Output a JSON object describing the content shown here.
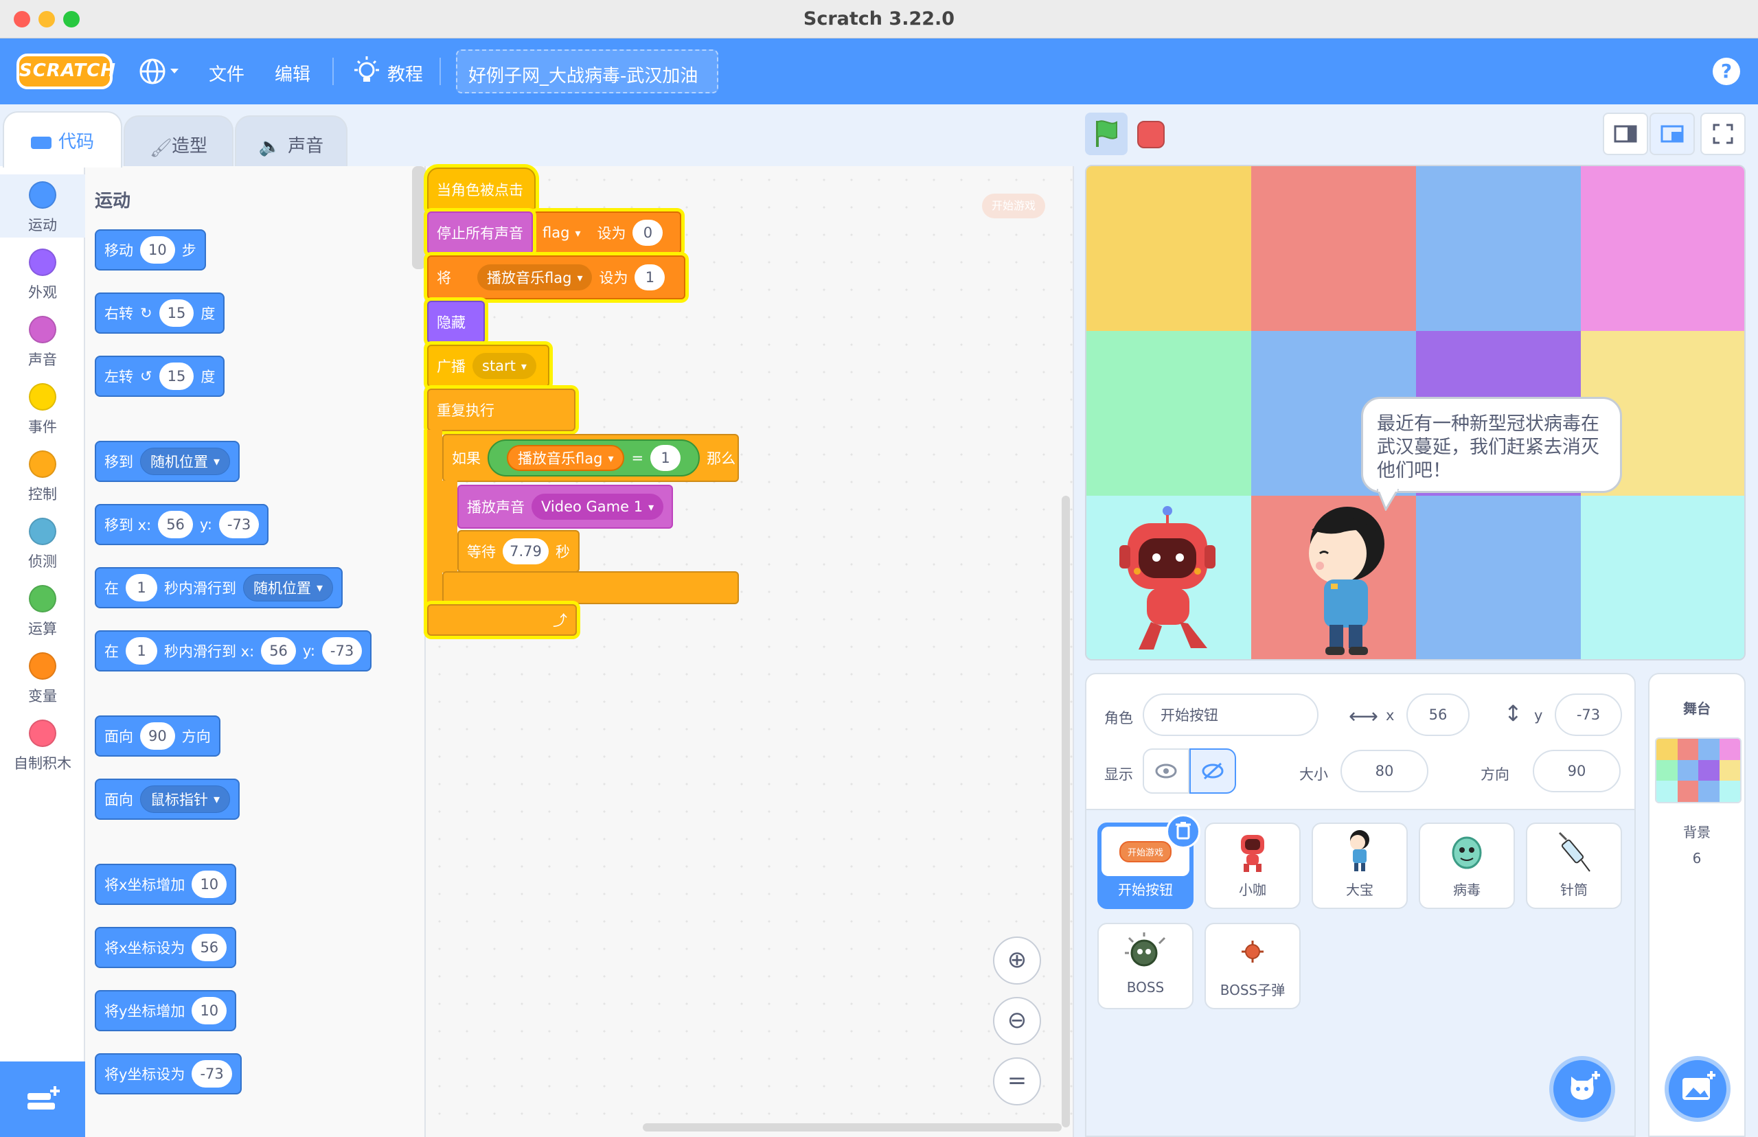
{
  "window": {
    "title": "Scratch 3.22.0"
  },
  "menubar": {
    "logo": "SCRATCH",
    "file": "文件",
    "edit": "编辑",
    "tutorials": "教程",
    "project_title": "好例子网_大战病毒-武汉加油",
    "help": "?"
  },
  "tabs": {
    "code": "代码",
    "costumes": "造型",
    "sounds": "声音"
  },
  "categories": [
    {
      "label": "运动",
      "color": "#4c97ff"
    },
    {
      "label": "外观",
      "color": "#9966ff"
    },
    {
      "label": "声音",
      "color": "#cf63cf"
    },
    {
      "label": "事件",
      "color": "#ffd500"
    },
    {
      "label": "控制",
      "color": "#ffab19"
    },
    {
      "label": "侦测",
      "color": "#5cb1d6"
    },
    {
      "label": "运算",
      "color": "#59c059"
    },
    {
      "label": "变量",
      "color": "#ff8c1a"
    },
    {
      "label": "自制积木",
      "color": "#ff6680"
    }
  ],
  "palette": {
    "heading": "运动",
    "move": {
      "a": "移动",
      "v": "10",
      "b": "步"
    },
    "turn_right": {
      "a": "右转",
      "v": "15",
      "b": "度"
    },
    "turn_left": {
      "a": "左转",
      "v": "15",
      "b": "度"
    },
    "goto": {
      "a": "移到",
      "d": "随机位置"
    },
    "goto_xy": {
      "a": "移到 x:",
      "x": "56",
      "yl": "y:",
      "y": "-73"
    },
    "glide": {
      "a": "在",
      "v": "1",
      "b": "秒内滑行到",
      "d": "随机位置"
    },
    "glide_xy": {
      "a": "在",
      "v": "1",
      "b": "秒内滑行到 x:",
      "x": "56",
      "yl": "y:",
      "y": "-73"
    },
    "point": {
      "a": "面向",
      "v": "90",
      "b": "方向"
    },
    "point_towards": {
      "a": "面向",
      "d": "鼠标指针"
    },
    "change_x": {
      "a": "将x坐标增加",
      "v": "10"
    },
    "set_x": {
      "a": "将x坐标设为",
      "v": "56"
    },
    "change_y": {
      "a": "将y坐标增加",
      "v": "10"
    },
    "set_y": {
      "a": "将y坐标设为",
      "v": "-73"
    }
  },
  "script": {
    "hat": "当角色被点击",
    "stop_sounds": "停止所有声音",
    "set1": {
      "var": "flag",
      "to": "设为",
      "v": "0"
    },
    "set2": {
      "a": "将",
      "var": "播放音乐flag",
      "to": "设为",
      "v": "1"
    },
    "hide": "隐藏",
    "broadcast": {
      "a": "广播",
      "msg": "start"
    },
    "forever": "重复执行",
    "if": {
      "a": "如果",
      "var": "播放音乐flag",
      "eq": "=",
      "v": "1",
      "then": "那么"
    },
    "play": {
      "a": "播放声音",
      "snd": "Video Game 1"
    },
    "wait": {
      "a": "等待",
      "v": "7.79",
      "b": "秒"
    },
    "ghost_label": "开始游戏"
  },
  "stage": {
    "bubble": "最近有一种新型冠状病毒在武汉蔓延，我们赶紧去消灭他们吧！",
    "grid_colors": [
      [
        "#f8d565",
        "#f08a84",
        "#87b8f3",
        "#f094e4"
      ],
      [
        "#9ef4c0",
        "#87b8f3",
        "#a06de9",
        "#f8e48f"
      ],
      [
        "#b6f7f4",
        "#f08a84",
        "#87b8f3",
        "#b6f7f4"
      ]
    ]
  },
  "sprite_info": {
    "sprite_label": "角色",
    "sprite_name": "开始按钮",
    "x_label": "x",
    "x": "56",
    "y_label": "y",
    "y": "-73",
    "show_label": "显示",
    "size_label": "大小",
    "size": "80",
    "direction_label": "方向",
    "direction": "90"
  },
  "sprites": [
    {
      "name": "开始按钮",
      "thumb": "开始游戏"
    },
    {
      "name": "小咖"
    },
    {
      "name": "大宝"
    },
    {
      "name": "病毒"
    },
    {
      "name": "针筒"
    },
    {
      "name": "BOSS"
    },
    {
      "name": "BOSS子弹"
    }
  ],
  "stage_panel": {
    "title": "舞台",
    "backdrops_label": "背景",
    "backdrops_count": "6"
  }
}
